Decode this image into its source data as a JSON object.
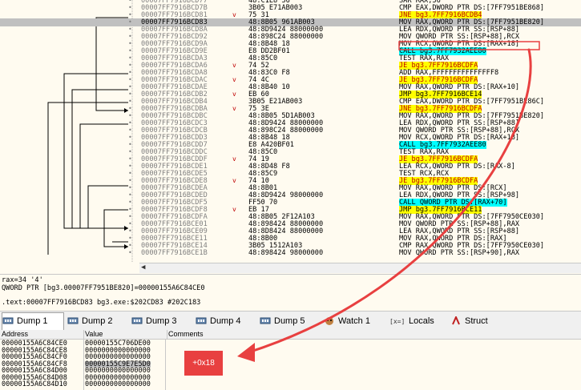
{
  "disasm": {
    "rows": [
      {
        "addr": "00007FF7916BCD77",
        "arrow": "",
        "bytes": "48:C1E8 36",
        "asm": [
          {
            "t": "SAR RAX,36"
          }
        ]
      },
      {
        "addr": "00007FF7916BCD7B",
        "arrow": "",
        "bytes": "3B05 E71AB003",
        "asm": [
          {
            "t": "CMP EAX,DWORD PTR DS:[7FF7951BE868]"
          }
        ]
      },
      {
        "addr": "00007FF7916BCD81",
        "arrow": "v",
        "bytes": "75 31",
        "asm": [
          {
            "t": "JNE bg3.7FF7916BCDB4",
            "c": "yel-red"
          }
        ]
      },
      {
        "addr": "00007FF7916BCD83",
        "arrow": "",
        "bytes": "48:8B05 961AB003",
        "sel": true,
        "asm": [
          {
            "t": "MOV RAX,QWORD PTR DS:[7FF7951BE820]"
          }
        ]
      },
      {
        "addr": "00007FF7916BCD8A",
        "arrow": "",
        "bytes": "48:8D9424 88000000",
        "asm": [
          {
            "t": "LEA RDX,QWORD PTR SS:[RSP+88]"
          }
        ]
      },
      {
        "addr": "00007FF7916BCD92",
        "arrow": "",
        "bytes": "48:898C24 88000000",
        "asm": [
          {
            "t": "MOV QWORD PTR SS:[RSP+88],RCX"
          }
        ]
      },
      {
        "addr": "00007FF7916BCD9A",
        "arrow": "",
        "bytes": "48:8B48 18",
        "asm": [
          {
            "t": "MOV RCX,QWORD PTR DS:[RAX+18]"
          }
        ]
      },
      {
        "addr": "00007FF7916BCD9E",
        "arrow": "",
        "bytes": "E8 DD2BF01",
        "asm": [
          {
            "t": "CALL bg3.7FF7932AEE80",
            "c": "cyan"
          }
        ]
      },
      {
        "addr": "00007FF7916BCDA3",
        "arrow": "",
        "bytes": "48:85C0",
        "asm": [
          {
            "t": "TEST RAX,RAX"
          }
        ]
      },
      {
        "addr": "00007FF7916BCDA6",
        "arrow": "v",
        "bytes": "74 52",
        "asm": [
          {
            "t": "JE bg3.7FF7916BCDFA",
            "c": "yel-red"
          }
        ]
      },
      {
        "addr": "00007FF7916BCDA8",
        "arrow": "",
        "bytes": "48:83C0 F8",
        "asm": [
          {
            "t": "ADD RAX,FFFFFFFFFFFFFFF8"
          }
        ]
      },
      {
        "addr": "00007FF7916BCDAC",
        "arrow": "v",
        "bytes": "74 4C",
        "asm": [
          {
            "t": "JE bg3.7FF7916BCDFA",
            "c": "yel-red"
          }
        ]
      },
      {
        "addr": "00007FF7916BCDAE",
        "arrow": "",
        "bytes": "48:8B40 10",
        "asm": [
          {
            "t": "MOV RAX,QWORD PTR DS:[RAX+10]"
          }
        ]
      },
      {
        "addr": "00007FF7916BCDB2",
        "arrow": "v",
        "bytes": "EB 60",
        "asm": [
          {
            "t": "JMP bg3.7FF7916BCE14",
            "c": "yel"
          }
        ]
      },
      {
        "addr": "00007FF7916BCDB4",
        "arrow": "",
        "bytes": "3B05 E21AB003",
        "asm": [
          {
            "t": "CMP EAX,DWORD PTR DS:[7FF7951BE86C]"
          }
        ]
      },
      {
        "addr": "00007FF7916BCDBA",
        "arrow": "v",
        "bytes": "75 3E",
        "asm": [
          {
            "t": "JNE bg3.7FF7916BCDFA",
            "c": "yel-red"
          }
        ]
      },
      {
        "addr": "00007FF7916BCDBC",
        "arrow": "",
        "bytes": "48:8B05 5D1AB003",
        "asm": [
          {
            "t": "MOV RAX,QWORD PTR DS:[7FF7951BE820]"
          }
        ]
      },
      {
        "addr": "00007FF7916BCDC3",
        "arrow": "",
        "bytes": "48:8D9424 88000000",
        "asm": [
          {
            "t": "LEA RDX,QWORD PTR SS:[RSP+88]"
          }
        ]
      },
      {
        "addr": "00007FF7916BCDCB",
        "arrow": "",
        "bytes": "48:898C24 88000000",
        "asm": [
          {
            "t": "MOV QWORD PTR SS:[RSP+88],RCX"
          }
        ]
      },
      {
        "addr": "00007FF7916BCDD3",
        "arrow": "",
        "bytes": "48:8B48 18",
        "asm": [
          {
            "t": "MOV RCX,QWORD PTR DS:[RAX+18]"
          }
        ]
      },
      {
        "addr": "00007FF7916BCDD7",
        "arrow": "",
        "bytes": "E8 A420BF01",
        "asm": [
          {
            "t": "CALL bg3.7FF7932AEE80",
            "c": "cyan"
          }
        ]
      },
      {
        "addr": "00007FF7916BCDDC",
        "arrow": "",
        "bytes": "48:85C0",
        "asm": [
          {
            "t": "TEST RAX,RAX"
          }
        ]
      },
      {
        "addr": "00007FF7916BCDDF",
        "arrow": "v",
        "bytes": "74 19",
        "asm": [
          {
            "t": "JE bg3.7FF7916BCDFA",
            "c": "yel-red"
          }
        ]
      },
      {
        "addr": "00007FF7916BCDE1",
        "arrow": "",
        "bytes": "48:8D48 F8",
        "asm": [
          {
            "t": "LEA RCX,QWORD PTR DS:[RAX-8]"
          }
        ]
      },
      {
        "addr": "00007FF7916BCDE5",
        "arrow": "",
        "bytes": "48:85C9",
        "asm": [
          {
            "t": "TEST RCX,RCX"
          }
        ]
      },
      {
        "addr": "00007FF7916BCDE8",
        "arrow": "v",
        "bytes": "74 10",
        "asm": [
          {
            "t": "JE bg3.7FF7916BCDFA",
            "c": "yel-red"
          }
        ]
      },
      {
        "addr": "00007FF7916BCDEA",
        "arrow": "",
        "bytes": "48:8B01",
        "asm": [
          {
            "t": "MOV RAX,QWORD PTR DS:[RCX]"
          }
        ]
      },
      {
        "addr": "00007FF7916BCDED",
        "arrow": "",
        "bytes": "48:8D9424 98000000",
        "asm": [
          {
            "t": "LEA RDX,QWORD PTR SS:[RSP+98]"
          }
        ]
      },
      {
        "addr": "00007FF7916BCDF5",
        "arrow": "",
        "bytes": "FF50 70",
        "asm": [
          {
            "t": "CALL QWORD PTR DS:[RAX+70]",
            "c": "cyan"
          }
        ]
      },
      {
        "addr": "00007FF7916BCDF8",
        "arrow": "v",
        "bytes": "EB 17",
        "asm": [
          {
            "t": "JMP bg3.7FF7916BCE11",
            "c": "yel"
          }
        ]
      },
      {
        "addr": "00007FF7916BCDFA",
        "arrow": "",
        "bytes": "48:8B05 2F12A103",
        "asm": [
          {
            "t": "MOV RAX,QWORD PTR DS:[7FF7950CE030]"
          }
        ]
      },
      {
        "addr": "00007FF7916BCE01",
        "arrow": "",
        "bytes": "48:898424 88000000",
        "asm": [
          {
            "t": "MOV QWORD PTR SS:[RSP+88],RAX"
          }
        ]
      },
      {
        "addr": "00007FF7916BCE09",
        "arrow": "",
        "bytes": "48:8D8424 88000000",
        "asm": [
          {
            "t": "LEA RAX,QWORD PTR SS:[RSP+88]"
          }
        ]
      },
      {
        "addr": "00007FF7916BCE11",
        "arrow": "",
        "bytes": "48:8B00",
        "asm": [
          {
            "t": "MOV RAX,QWORD PTR DS:[RAX]"
          }
        ]
      },
      {
        "addr": "00007FF7916BCE14",
        "arrow": "",
        "bytes": "3B05 1512A103",
        "asm": [
          {
            "t": "CMP RAX,QWORD PTR DS:[7FF7950CE030]"
          }
        ]
      },
      {
        "addr": "00007FF7916BCE1B",
        "arrow": "",
        "bytes": "48:898424 98000000",
        "asm": [
          {
            "t": "MOV QWORD PTR SS:[RSP+90],RAX"
          }
        ]
      }
    ]
  },
  "info": {
    "line1": "rax=34 '4'",
    "line2": "QWORD PTR [bg3.00007FF7951BE820]=00000155A6C84CE0",
    "line3": ".text:00007FF7916BCD83 bg3.exe:$202CD83 #202C183"
  },
  "tabs": [
    {
      "label": "Dump 1",
      "icon": "memory-icon",
      "active": true
    },
    {
      "label": "Dump 2",
      "icon": "memory-icon"
    },
    {
      "label": "Dump 3",
      "icon": "memory-icon"
    },
    {
      "label": "Dump 4",
      "icon": "memory-icon"
    },
    {
      "label": "Dump 5",
      "icon": "memory-icon"
    },
    {
      "label": "Watch 1",
      "icon": "watch-icon"
    },
    {
      "label": "Locals",
      "icon": "locals-icon",
      "prefix": "[x=]"
    },
    {
      "label": "Struct",
      "icon": "struct-icon"
    }
  ],
  "dump": {
    "headers": {
      "address": "Address",
      "value": "Value",
      "comments": "Comments"
    },
    "rows": [
      {
        "addr": "00000155A6C84CE0",
        "val": "00000155C706DE00"
      },
      {
        "addr": "00000155A6C84CE8",
        "val": "0000000000000000"
      },
      {
        "addr": "00000155A6C84CF0",
        "val": "0000000000000000"
      },
      {
        "addr": "00000155A6C84CF8",
        "val": "00000155C9E7E5D0",
        "sel": true
      },
      {
        "addr": "00000155A6C84D00",
        "val": "0000000000000000"
      },
      {
        "addr": "00000155A6C84D08",
        "val": "0000000000000000"
      },
      {
        "addr": "00000155A6C84D10",
        "val": "0000000000000000"
      }
    ]
  },
  "annotation": {
    "label": "+0x18",
    "color": "#e84040"
  }
}
